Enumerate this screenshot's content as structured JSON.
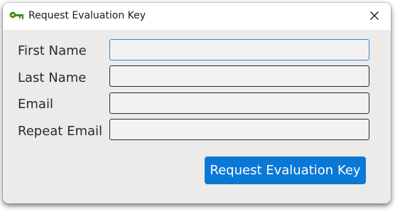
{
  "window": {
    "title": "Request Evaluation Key",
    "app_icon": "key-icon",
    "close_icon": "close-icon"
  },
  "form": {
    "fields": [
      {
        "label": "First Name",
        "value": "",
        "focused": true
      },
      {
        "label": "Last Name",
        "value": ""
      },
      {
        "label": "Email",
        "value": ""
      },
      {
        "label": "Repeat Email",
        "value": ""
      }
    ],
    "submit_label": "Request Evaluation Key"
  },
  "colors": {
    "accent": "#0a78d7",
    "focus_border": "#2f88d6",
    "window_bg": "#edebe9"
  }
}
